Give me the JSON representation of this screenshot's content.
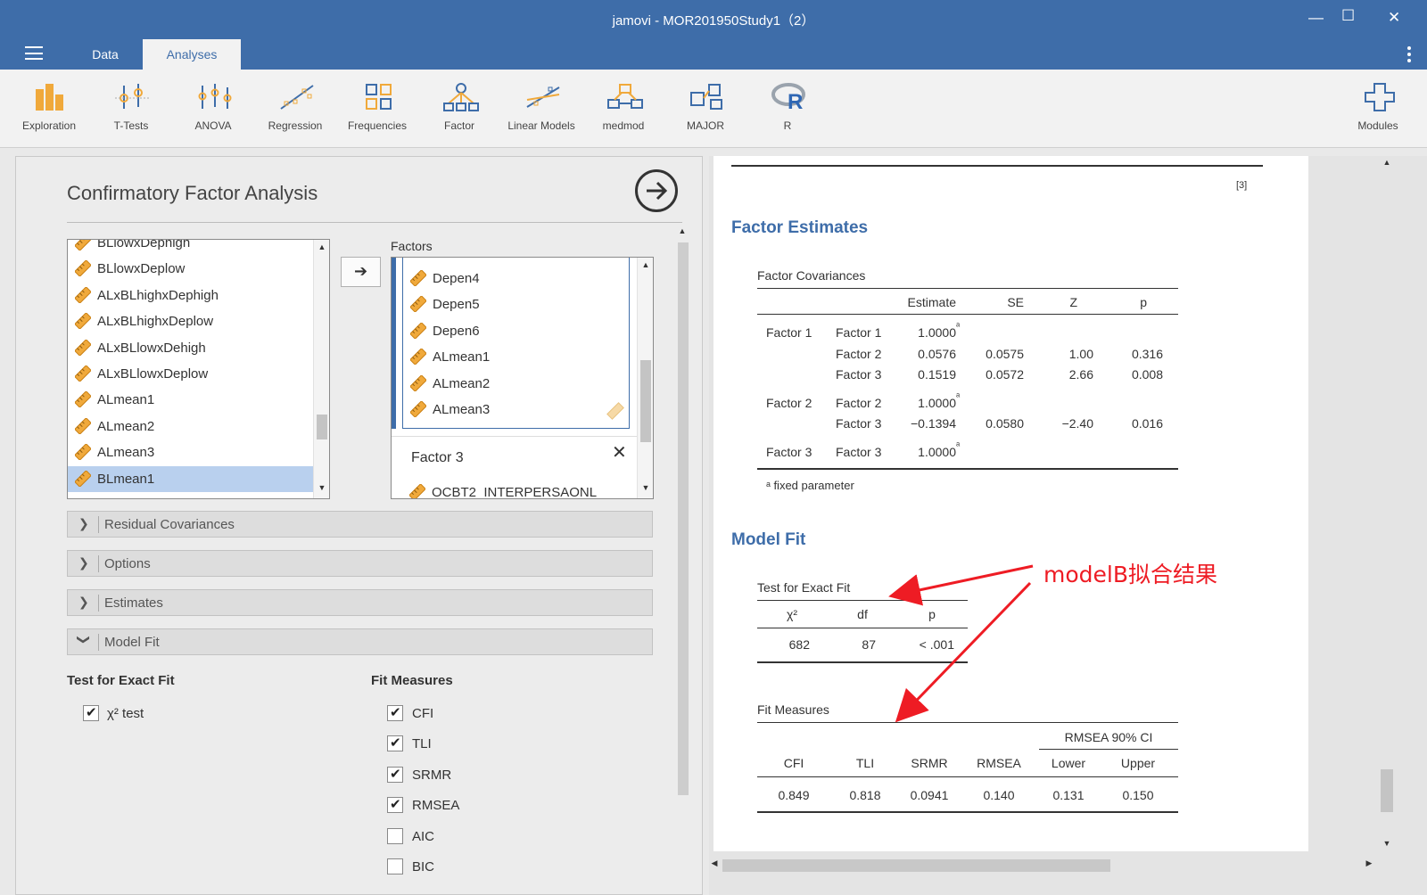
{
  "window": {
    "title": "jamovi - MOR201950Study1（2）"
  },
  "tabs": [
    {
      "label": "Data"
    },
    {
      "label": "Analyses"
    }
  ],
  "ribbon": [
    {
      "label": "Exploration",
      "icon": "exploration-icon"
    },
    {
      "label": "T-Tests",
      "icon": "ttests-icon"
    },
    {
      "label": "ANOVA",
      "icon": "anova-icon"
    },
    {
      "label": "Regression",
      "icon": "regression-icon"
    },
    {
      "label": "Frequencies",
      "icon": "frequencies-icon"
    },
    {
      "label": "Factor",
      "icon": "factor-icon"
    },
    {
      "label": "Linear Models",
      "icon": "linear-models-icon"
    },
    {
      "label": "medmod",
      "icon": "medmod-icon"
    },
    {
      "label": "MAJOR",
      "icon": "major-icon"
    },
    {
      "label": "R",
      "icon": "r-icon"
    },
    {
      "label": "Modules",
      "icon": "plus-icon"
    }
  ],
  "analysis": {
    "title": "Confirmatory Factor Analysis",
    "variables": [
      "BLlowxDephigh",
      "BLlowxDeplow",
      "ALxBLhighxDephigh",
      "ALxBLhighxDeplow",
      "ALxBLlowxDehigh",
      "ALxBLlowxDeplow",
      "ALmean1",
      "ALmean2",
      "ALmean3",
      "BLmean1"
    ],
    "selected_variable": "BLmean1",
    "factors_label": "Factors",
    "factor_items": [
      "Depen4",
      "Depen5",
      "Depen6",
      "ALmean1",
      "ALmean2",
      "ALmean3"
    ],
    "factor3": {
      "name": "Factor 3",
      "items": [
        "OCBT2_INTERPERSAONL"
      ]
    },
    "sections": [
      "Residual Covariances",
      "Options",
      "Estimates",
      "Model Fit"
    ],
    "test_exact_fit": {
      "heading": "Test for Exact Fit",
      "options": [
        {
          "label": "χ² test",
          "checked": true
        }
      ]
    },
    "fit_measures": {
      "heading": "Fit Measures",
      "options": [
        {
          "label": "CFI",
          "checked": true
        },
        {
          "label": "TLI",
          "checked": true
        },
        {
          "label": "SRMR",
          "checked": true
        },
        {
          "label": "RMSEA",
          "checked": true
        },
        {
          "label": "AIC",
          "checked": false
        },
        {
          "label": "BIC",
          "checked": false
        }
      ]
    }
  },
  "results": {
    "ref": "[3]",
    "factor_estimates_title": "Factor Estimates",
    "factor_cov": {
      "caption": "Factor Covariances",
      "headers": [
        "Estimate",
        "SE",
        "Z",
        "p"
      ],
      "rows": [
        {
          "f1": "Factor 1",
          "f2": "Factor 1",
          "est": "1.0000",
          "sup": "ᵃ",
          "se": "",
          "z": "",
          "p": ""
        },
        {
          "f1": "",
          "f2": "Factor 2",
          "est": "0.0576",
          "sup": "",
          "se": "0.0575",
          "z": "1.00",
          "p": "0.316"
        },
        {
          "f1": "",
          "f2": "Factor 3",
          "est": "0.1519",
          "sup": "",
          "se": "0.0572",
          "z": "2.66",
          "p": "0.008"
        },
        {
          "f1": "Factor 2",
          "f2": "Factor 2",
          "est": "1.0000",
          "sup": "ᵃ",
          "se": "",
          "z": "",
          "p": ""
        },
        {
          "f1": "",
          "f2": "Factor 3",
          "est": "−0.1394",
          "sup": "",
          "se": "0.0580",
          "z": "−2.40",
          "p": "0.016"
        },
        {
          "f1": "Factor 3",
          "f2": "Factor 3",
          "est": "1.0000",
          "sup": "ᵃ",
          "se": "",
          "z": "",
          "p": ""
        }
      ],
      "footnote": "ᵃ fixed parameter"
    },
    "model_fit_title": "Model Fit",
    "exact_fit": {
      "caption": "Test for Exact Fit",
      "headers": [
        "χ²",
        "df",
        "p"
      ],
      "row": [
        "682",
        "87",
        "< .001"
      ]
    },
    "fit_measures": {
      "caption": "Fit Measures",
      "group_header": "RMSEA 90% CI",
      "headers": [
        "CFI",
        "TLI",
        "SRMR",
        "RMSEA",
        "Lower",
        "Upper"
      ],
      "row": [
        "0.849",
        "0.818",
        "0.0941",
        "0.140",
        "0.131",
        "0.150"
      ]
    }
  },
  "annotation": {
    "text": "modelB拟合结果",
    "color": "#ee1c24"
  },
  "colors": {
    "brand": "#3e6da9",
    "heading": "#3e6da9",
    "selection": "#b9d0ee",
    "ruler": "#f0a93b"
  }
}
